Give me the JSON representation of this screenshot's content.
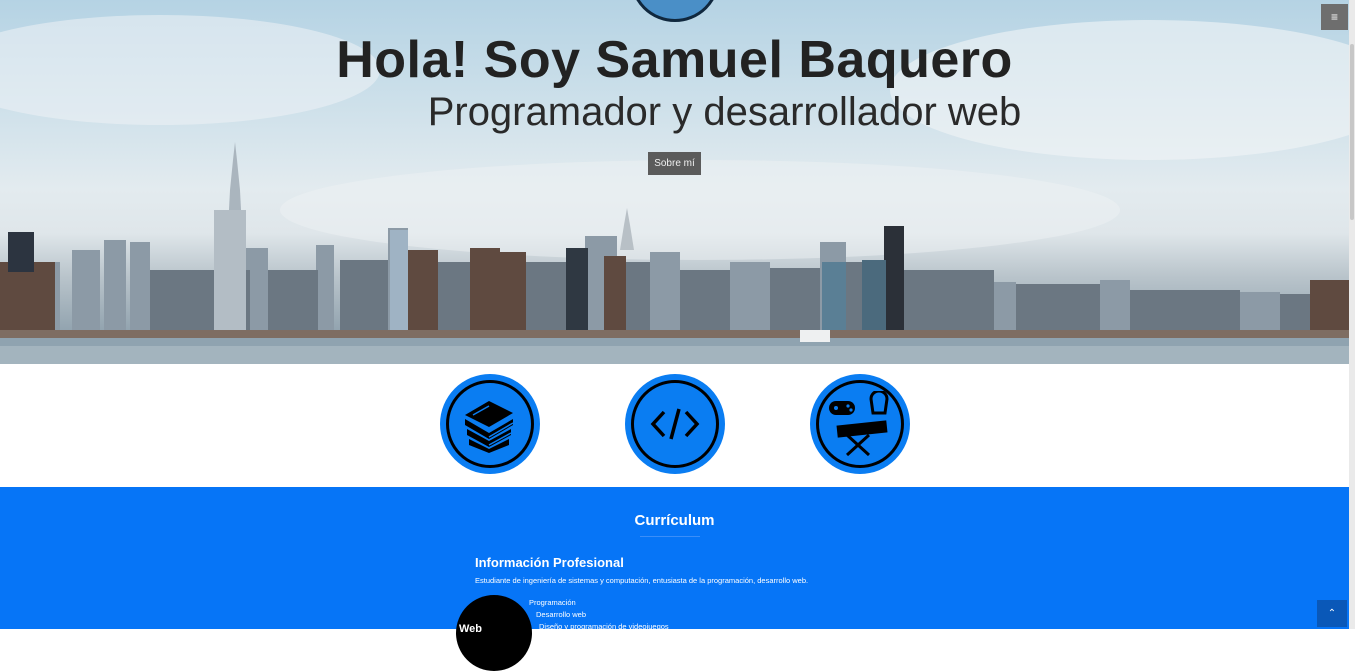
{
  "hero": {
    "title": "Hola! Soy Samuel Baquero",
    "subtitle": "Programador y desarrollador web",
    "about_button": "Sobre mí"
  },
  "nav": {
    "menu_icon": "hamburger-icon",
    "menu_glyph": "≡"
  },
  "features": [
    {
      "icon": "books-icon"
    },
    {
      "icon": "code-icon"
    },
    {
      "icon": "gaming-music-icon"
    }
  ],
  "curriculum": {
    "title": "Currículum",
    "subtitle": "Información Profesional",
    "description": "Estudiante de ingeniería de sistemas y computación, entusiasta de la programación, desarrollo web.",
    "skills": [
      "Programación",
      "Desarrollo web",
      "Diseño y programación de videojuegos"
    ],
    "circle_label": "Web"
  },
  "scroll_top": {
    "icon": "chevron-up-icon",
    "glyph": "⌃"
  },
  "colors": {
    "accent": "#0675f7",
    "icon_blue": "#0a7df2",
    "button_gray": "#5b5b5b"
  }
}
